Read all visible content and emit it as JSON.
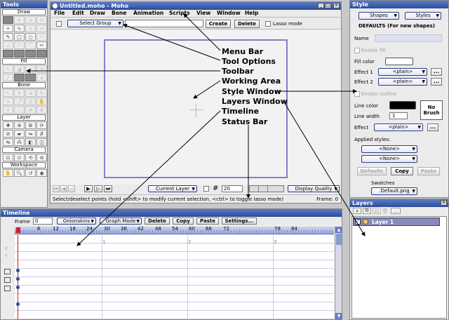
{
  "tools": {
    "title": "Tools",
    "sections": [
      "Draw",
      "Fill",
      "Bone",
      "Layer",
      "Camera",
      "Workspace"
    ]
  },
  "main": {
    "title": "Untitled.moho - Moho",
    "menu": [
      "File",
      "Edit",
      "Draw",
      "Bone",
      "Animation",
      "Scripts",
      "View",
      "Window",
      "Help"
    ],
    "tool_options": {
      "select_group": "Select Group",
      "create": "Create",
      "delete": "Delete",
      "lasso_mode": "Lasso mode"
    },
    "toolbar": {
      "layer_select": "Current Layer",
      "grid_size": "20",
      "display_quality": "Display Quality"
    },
    "status": {
      "message": "Select/deselect points (hold <shift> to modify current selection, <ctrl> to toggle lasso mode)",
      "frame": "Frame: 0"
    }
  },
  "annotations": [
    "Menu Bar",
    "Tool Options",
    "Toolbar",
    "Working Area",
    "Style Window",
    "Layers Window",
    "Timeline",
    "Status Bar"
  ],
  "timeline": {
    "title": "Timeline",
    "frame_label": "Frame",
    "frame_value": "0",
    "onionskins": "Onionskins",
    "graph_mode": "Graph Mode",
    "buttons": {
      "delete": "Delete",
      "copy": "Copy",
      "paste": "Paste",
      "settings": "Settings..."
    },
    "ruler_ticks": [
      "6",
      "12",
      "18",
      "24",
      "30",
      "36",
      "42",
      "48",
      "54",
      "60",
      "66",
      "72",
      "78",
      "84"
    ],
    "second_marks": [
      "1",
      "2",
      "3"
    ]
  },
  "style": {
    "title": "Style",
    "shapes": "Shapes",
    "styles": "Styles",
    "defaults": "DEFAULTS (For new shapes)",
    "name_label": "Name",
    "enable_fill": "Enable fill",
    "fill_color": "Fill color",
    "effect1_label": "Effect 1",
    "effect2_label": "Effect 2",
    "plain": "<plain>",
    "more": "...",
    "enable_outline": "Enable outline",
    "line_color": "Line color",
    "line_width": "Line width",
    "line_width_value": "1",
    "no_brush": "No Brush",
    "effect_label": "Effect",
    "applied_styles": "Applied styles:",
    "none": "<None>",
    "defaults_btn": "Defaults",
    "copy_btn": "Copy",
    "paste_btn": "Paste",
    "swatches_label": "Swatches",
    "swatch_file": ".Default.png"
  },
  "layers": {
    "title": "Layers",
    "layer1": "Layer 1"
  },
  "colors": {
    "title_bar": "#2c4c98",
    "canvas_frame": "#8080cc",
    "line_color": "#000000",
    "layer_selected": "#8a8aba"
  }
}
